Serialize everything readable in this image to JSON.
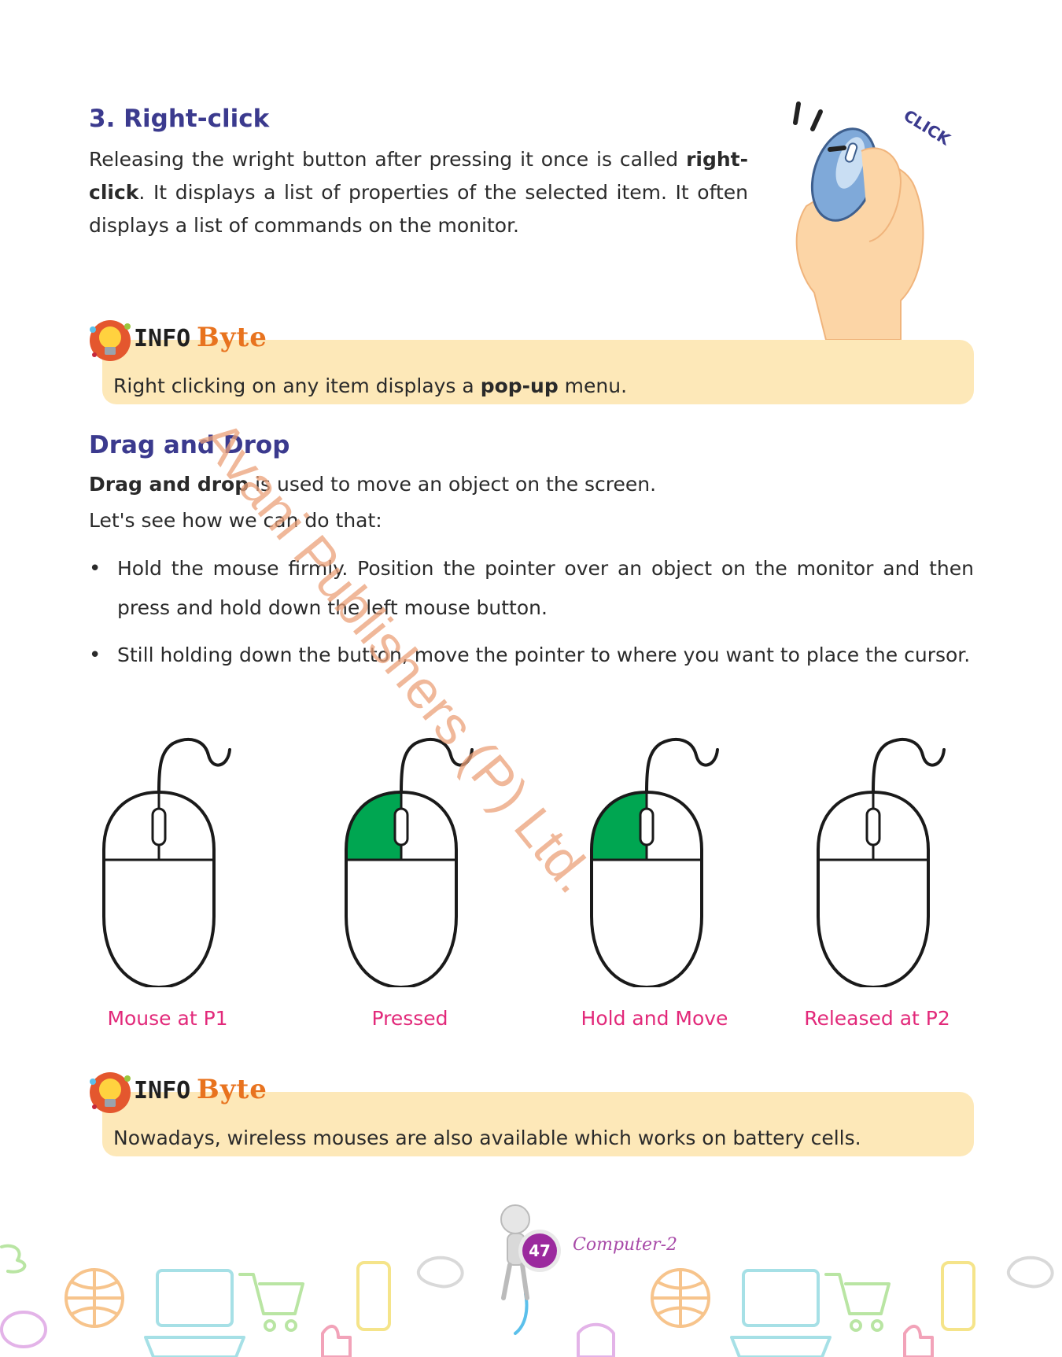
{
  "section_right_click": {
    "title": "3. Right-click",
    "p_pre": "Releasing the wright button after pressing it once is called ",
    "p_bold": "right-click",
    "p_post": ". It displays a list of properties  of the selected item. It often displays a list of commands on the monitor.",
    "click_text": "CLICK"
  },
  "infobyte_label": {
    "info": "INFO",
    "byte": "Byte"
  },
  "info1": {
    "pre": "Right clicking on any item displays a ",
    "bold": "pop-up",
    "post": " menu."
  },
  "section_drag": {
    "title": "Drag and Drop",
    "intro_bold": "Drag and drop",
    "intro_rest": " is used to move an object on the screen.",
    "line2": "Let's see how we can do that:",
    "bullets": [
      "Hold the mouse firmly. Position the pointer over an object on the monitor and then press and hold down the left mouse button.",
      "Still holding down the button, move the pointer to where you want to place the cursor."
    ],
    "bullet_symbol": "•"
  },
  "mouse_steps": [
    {
      "label": "Mouse at P1",
      "left_pressed": false
    },
    {
      "label": "Pressed",
      "left_pressed": true
    },
    {
      "label": "Hold and Move",
      "left_pressed": true
    },
    {
      "label": "Released at P2",
      "left_pressed": false
    }
  ],
  "info2": {
    "text": "Nowadays, wireless mouses are also available  which works on battery cells."
  },
  "watermark": "Avani Publishers (P) Ltd.",
  "footer": {
    "page_number": "47",
    "book": "Computer-2"
  },
  "colors": {
    "heading": "#3b3a8e",
    "accent_label": "#e2297a",
    "pressed_fill": "#00a651",
    "info_bg": "#fde8b8"
  }
}
